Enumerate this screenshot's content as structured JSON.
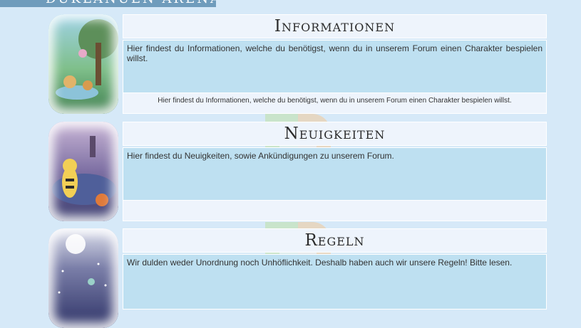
{
  "colors": {
    "page_background": "#d6e9f8",
    "banner": "#6f9cbc",
    "title_bar": "#eef4fc",
    "description_box": "#bee0f1"
  },
  "header": {
    "banner_text": "DUKLANUEN ARENA"
  },
  "forums": [
    {
      "title": "Informationen",
      "description": "Hier findest du Informationen, welche du benötigst, wenn du in unserem Forum einen Charakter bespielen willst.",
      "footer_text": "Hier findest du Informationen, welche du benötigst, wenn du in unserem Forum einen Charakter bespielen willst.",
      "image": "forest-pokemon-illustration"
    },
    {
      "title": "Neuigkeiten",
      "description": "Hier findest du Neuigkeiten, sowie Ankündigungen zu unserem Forum.",
      "footer_text": "",
      "image": "ampharos-lighthouse-illustration"
    },
    {
      "title": "Regeln",
      "description": "Wir dulden weder Unordnung noch Unhöflichkeit. Deshalb haben auch wir unsere Regeln! Bitte lesen.",
      "footer_text": "",
      "image": "night-sky-pokemon-illustration"
    }
  ]
}
